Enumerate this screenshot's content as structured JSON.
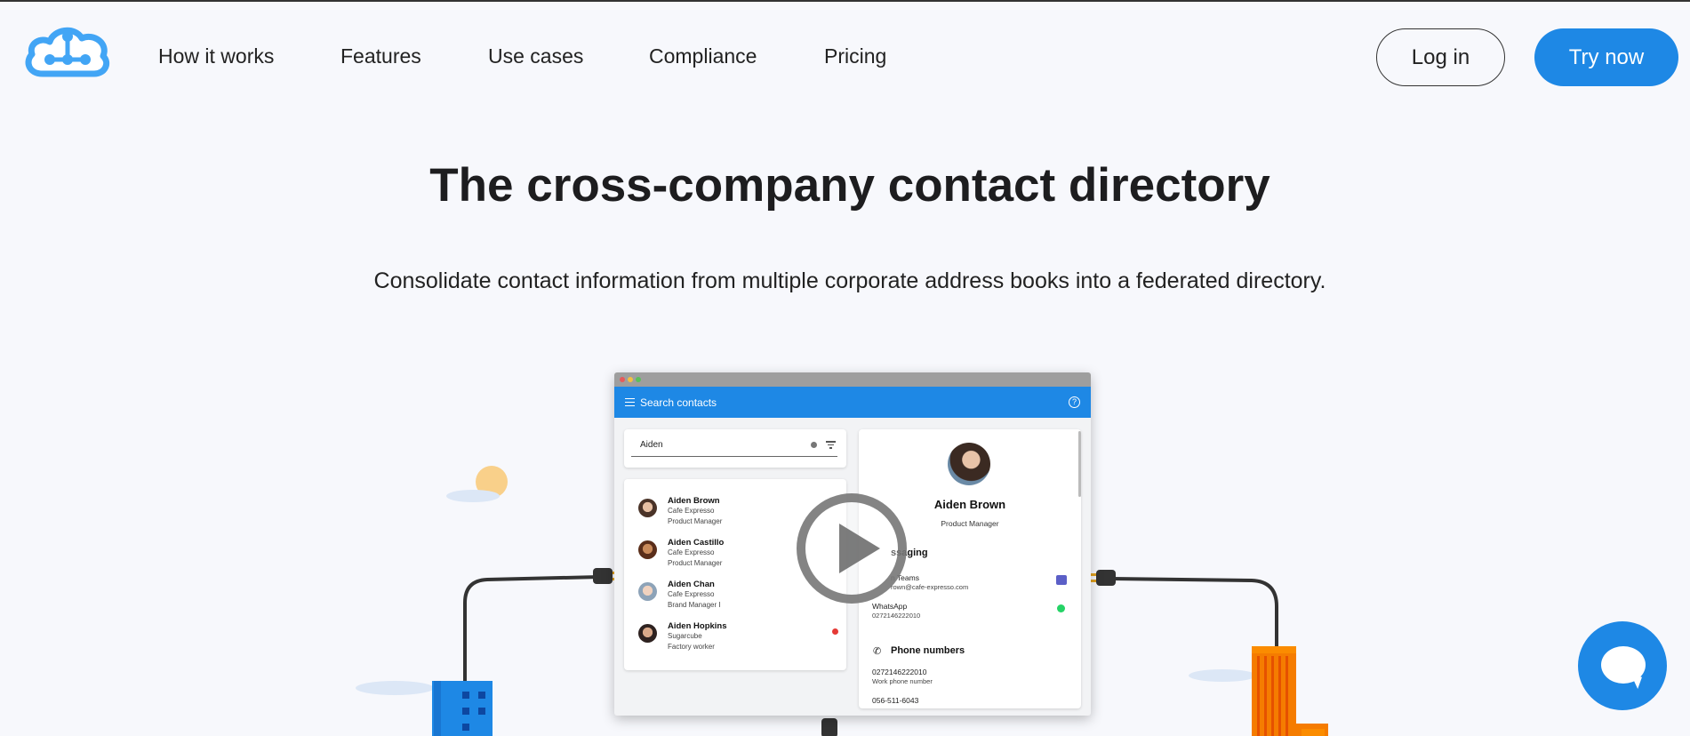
{
  "nav": {
    "links": [
      "How it works",
      "Features",
      "Use cases",
      "Compliance",
      "Pricing"
    ],
    "login_label": "Log in",
    "try_label": "Try now"
  },
  "hero": {
    "title": "The cross-company contact directory",
    "subtitle": "Consolidate contact information from multiple corporate address books into a federated directory."
  },
  "app": {
    "toolbar_title": "Search contacts",
    "search_value": "Aiden",
    "contacts": [
      {
        "name": "Aiden Brown",
        "company": "Cafe Expresso",
        "role": "Product Manager"
      },
      {
        "name": "Aiden Castillo",
        "company": "Cafe Expresso",
        "role": "Product Manager"
      },
      {
        "name": "Aiden Chan",
        "company": "Cafe Expresso",
        "role": "Brand Manager I"
      },
      {
        "name": "Aiden Hopkins",
        "company": "Sugarcube",
        "role": "Factory worker"
      }
    ],
    "detail": {
      "name": "Aiden Brown",
      "title": "Product Manager",
      "messaging_label": "ssaging",
      "teams_label": "n Teams",
      "teams_email": "rown@cafe-expresso.com",
      "whatsapp_label": "WhatsApp",
      "whatsapp_number": "0272146222010",
      "phone_label": "Phone numbers",
      "phone_1": "0272146222010",
      "phone_1_type": "Work phone number",
      "phone_2": "056-511-6043"
    }
  },
  "colors": {
    "brand_blue": "#1e88e5",
    "logo_blue": "#42a5f5",
    "building_blue": "#1e88e5",
    "building_orange": "#f57c00"
  },
  "icons": {
    "logo": "cloud-network-logo",
    "play": "play-icon",
    "chat": "chat-bubble-icon"
  }
}
